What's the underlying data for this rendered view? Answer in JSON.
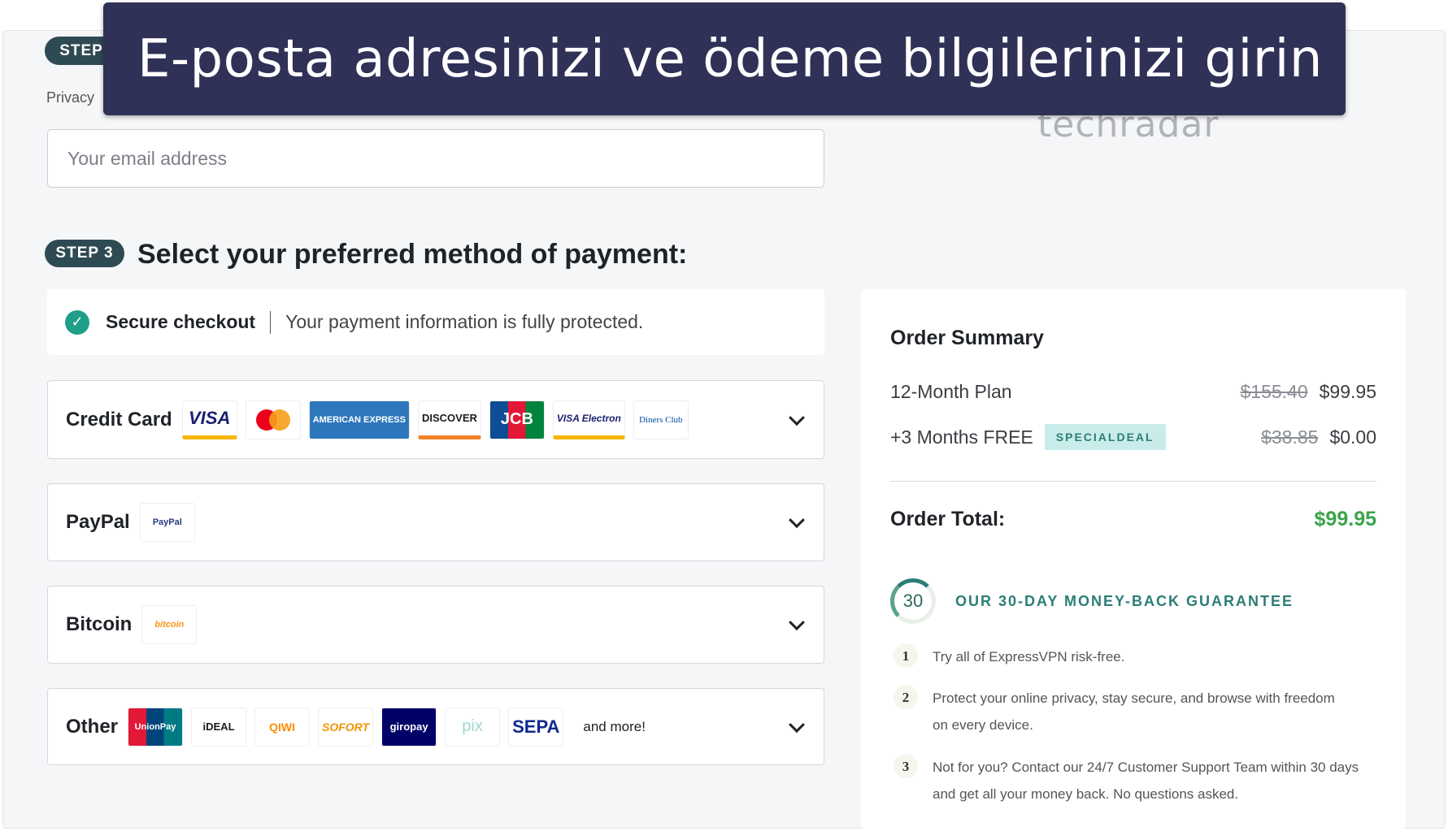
{
  "banner": {
    "title": "E-posta adresinizi ve ödeme bilgilerinizi girin"
  },
  "step2": {
    "badge": "STEP",
    "privacy_text": "Privacy",
    "email_placeholder": "Your email address"
  },
  "brand": {
    "logo_text": "techradar"
  },
  "step3": {
    "badge": "STEP 3",
    "heading": "Select your preferred method of payment:"
  },
  "secure": {
    "title": "Secure checkout",
    "text": "Your payment information is fully protected."
  },
  "payment_methods": [
    {
      "label": "Credit Card",
      "logos": [
        "VISA",
        "mastercard",
        "AMERICAN EXPRESS",
        "DISCOVER",
        "JCB",
        "VISA Electron",
        "Diners Club"
      ]
    },
    {
      "label": "PayPal",
      "logos": [
        "PayPal"
      ]
    },
    {
      "label": "Bitcoin",
      "logos": [
        "bitcoin"
      ]
    },
    {
      "label": "Other",
      "logos": [
        "UnionPay",
        "iDEAL",
        "QIWI",
        "SOFORT",
        "giropay",
        "pix",
        "SEPA"
      ],
      "more": "and more!"
    }
  ],
  "summary": {
    "title": "Order Summary",
    "plan": {
      "label": "12-Month Plan",
      "old_price": "$155.40",
      "price": "$99.95"
    },
    "bonus": {
      "label": "+3 Months FREE",
      "badge": "SPECIALDEAL",
      "old_price": "$38.85",
      "price": "$0.00"
    },
    "total_label": "Order Total:",
    "total": "$99.95",
    "guarantee": {
      "days": "30",
      "title": "OUR 30-DAY MONEY-BACK GUARANTEE",
      "items": [
        {
          "n": "1",
          "text": "Try all of ExpressVPN risk-free."
        },
        {
          "n": "2",
          "text": "Protect your online privacy, stay secure, and browse with freedom on every device."
        },
        {
          "n": "3",
          "text": "Not for you? Contact our 24/7 Customer Support Team within 30 days and get all your money back. No questions asked."
        }
      ]
    }
  },
  "colors": {
    "banner": "#2f3157",
    "pill": "#2e4a53",
    "accent_green": "#3aa34a",
    "guarantee": "#2b7e76"
  }
}
